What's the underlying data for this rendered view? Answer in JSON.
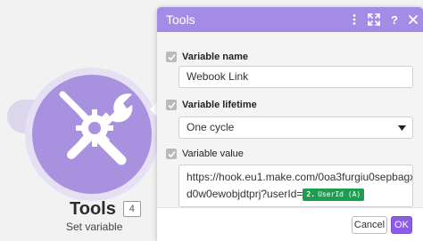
{
  "module": {
    "title": "Tools",
    "badge": "4",
    "subtitle": "Set variable",
    "icon": "wrench-gear-icon",
    "colors": {
      "circle": "#a892e0",
      "ring": "#e6e1f2"
    }
  },
  "dialog": {
    "title": "Tools",
    "header_icons": [
      "more-vertical-icon",
      "expand-icon",
      "help-icon",
      "close-icon"
    ],
    "colors": {
      "header": "#a48ce6",
      "ok_button": "#8b5ce6",
      "pill": "#1f9d4f"
    },
    "fields": {
      "variable_name": {
        "label": "Variable name",
        "value": "Webook Link"
      },
      "variable_lifetime": {
        "label": "Variable lifetime",
        "value": "One cycle"
      },
      "variable_value": {
        "label": "Variable value",
        "line1": "https://hook.eu1.make.com/0oa3furgiu0sepbagx",
        "line2_text": "d0w0ewobjdtprj?userId=",
        "pill_number": "2.",
        "pill_label": "UserId (A)"
      }
    },
    "footer": {
      "cancel_label": "Cancel",
      "ok_label": "OK"
    }
  }
}
